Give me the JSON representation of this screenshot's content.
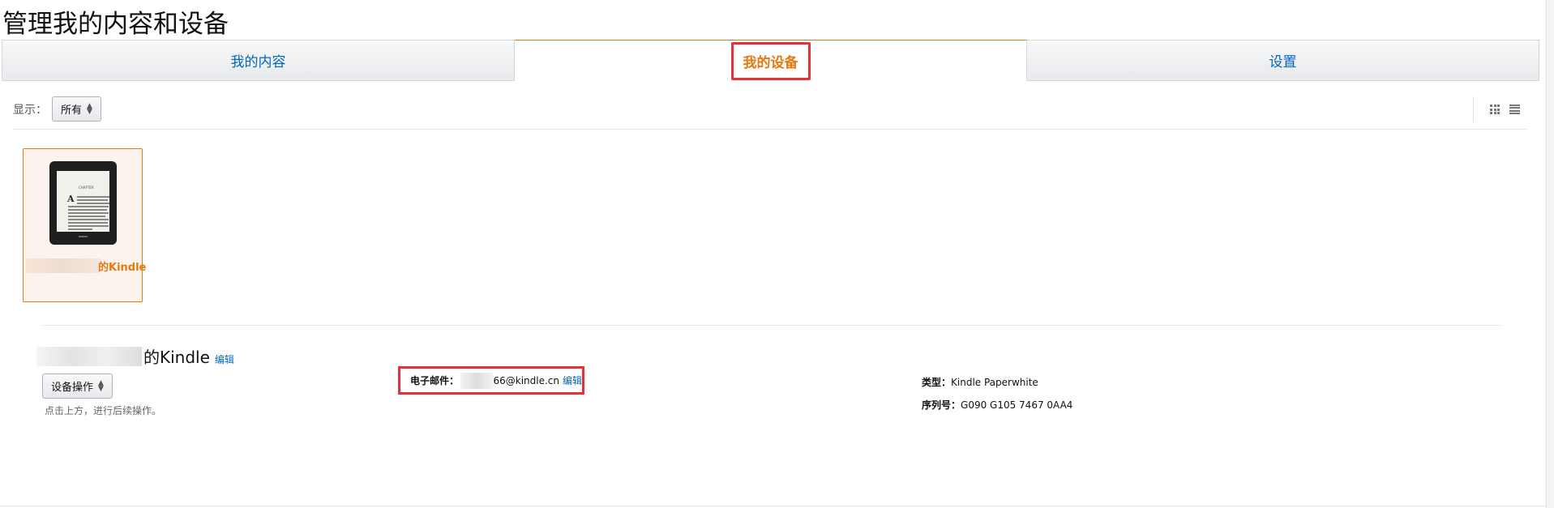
{
  "page": {
    "title": "管理我的内容和设备"
  },
  "tabs": [
    {
      "label": "我的内容",
      "active": false
    },
    {
      "label": "我的设备",
      "active": true
    },
    {
      "label": "设置",
      "active": false
    }
  ],
  "filter": {
    "label": "显示：",
    "value": "所有"
  },
  "view_toggle": {
    "icons": [
      "grid-icon",
      "list-icon"
    ]
  },
  "device_card": {
    "name_suffix": "的Kindle",
    "image": "kindle-paperwhite-image"
  },
  "details": {
    "name_suffix": "的Kindle",
    "edit_label": "编辑",
    "action_button": "设备操作",
    "hint": "点击上方，进行后续操作。",
    "email_label": "电子邮件：",
    "email_value": "66@kindle.cn",
    "email_edit": "编辑",
    "type_label": "类型：",
    "type_value": "Kindle Paperwhite",
    "serial_label": "序列号：",
    "serial_value": "G090 G105 7467 0AA4"
  },
  "colors": {
    "accent": "#e47911",
    "link": "#0066c0",
    "highlight": "#e2323c"
  }
}
